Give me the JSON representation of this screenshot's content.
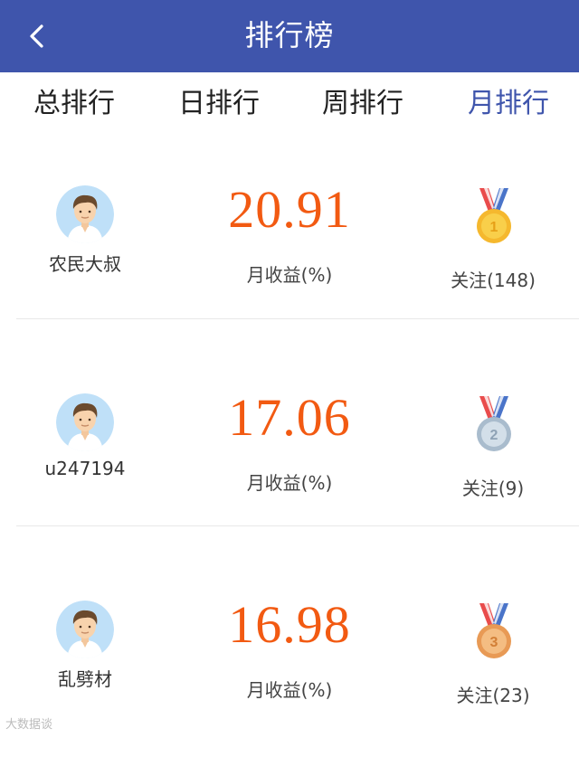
{
  "header": {
    "title": "排行榜",
    "back_icon": "chevron-left-icon",
    "background_color": "#3f55ac"
  },
  "tabs": [
    {
      "label": "总排行",
      "active": false
    },
    {
      "label": "日排行",
      "active": false
    },
    {
      "label": "周排行",
      "active": false
    },
    {
      "label": "月排行",
      "active": true
    }
  ],
  "ranking": [
    {
      "rank": 1,
      "name": "农民大叔",
      "value": "20.91",
      "value_label": "月收益(%)",
      "follow": "关注(148)",
      "medal": "gold-medal-icon",
      "medal_number": "1"
    },
    {
      "rank": 2,
      "name": "u247194",
      "value": "17.06",
      "value_label": "月收益(%)",
      "follow": "关注(9)",
      "medal": "silver-medal-icon",
      "medal_number": "2"
    },
    {
      "rank": 3,
      "name": "乱劈材",
      "value": "16.98",
      "value_label": "月收益(%)",
      "follow": "关注(23)",
      "medal": "bronze-medal-icon",
      "medal_number": "3"
    }
  ],
  "colors": {
    "accent": "#3f55ac",
    "value": "#f25a12"
  },
  "watermark": "大数据谈"
}
